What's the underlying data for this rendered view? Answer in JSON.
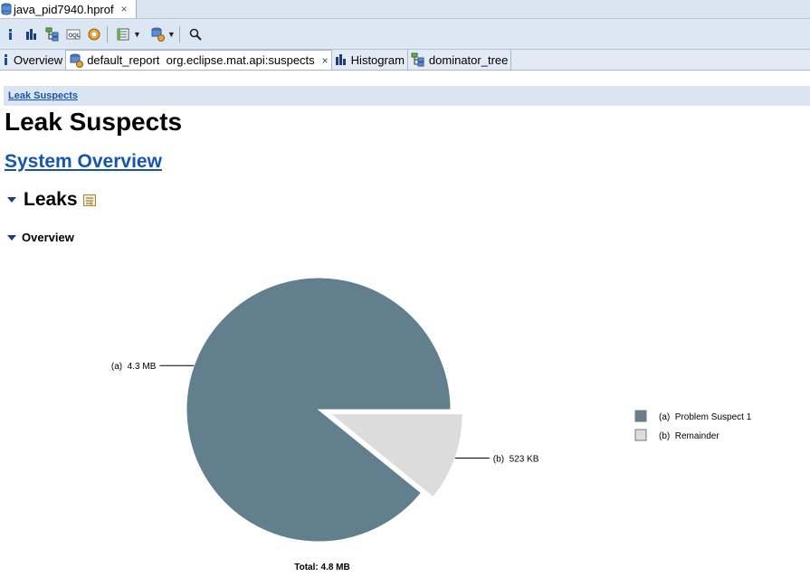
{
  "editor_tab": {
    "title": "java_pid7940.hprof",
    "close": "×"
  },
  "toolbar": {
    "icons": [
      "info-icon",
      "histogram-icon",
      "dominator-tree-icon",
      "oql-icon",
      "heap-dump-overview-icon",
      "query-browser-icon",
      "query-dropdown-icon",
      "run-report-icon",
      "report-dropdown-icon",
      "search-icon"
    ]
  },
  "report_tabs": [
    {
      "label": "Overview",
      "icon": "info-icon"
    },
    {
      "label": "default_report  org.eclipse.mat.api:suspects",
      "icon": "report-icon",
      "close": "×"
    },
    {
      "label": "Histogram",
      "icon": "histogram-icon"
    },
    {
      "label": "dominator_tree",
      "icon": "dominator-tree-icon"
    }
  ],
  "breadcrumb": "Leak Suspects",
  "page_title": "Leak Suspects",
  "system_overview": "System Overview",
  "leaks_heading": "Leaks",
  "overview_heading": "Overview",
  "colors": {
    "suspect": "#627f8e",
    "remainder": "#dcdcdc",
    "link": "#1555b2"
  },
  "chart_data": {
    "type": "pie",
    "total_label": "Total: 4.8 MB",
    "slices": [
      {
        "label": "(a)  4.3 MB",
        "legend": "(a)  Problem Suspect 1",
        "value": 4.3,
        "unit": "MB"
      },
      {
        "label": "(b)  523 KB",
        "legend": "(b)  Remainder",
        "value": 0.523,
        "unit": "MB"
      }
    ]
  }
}
